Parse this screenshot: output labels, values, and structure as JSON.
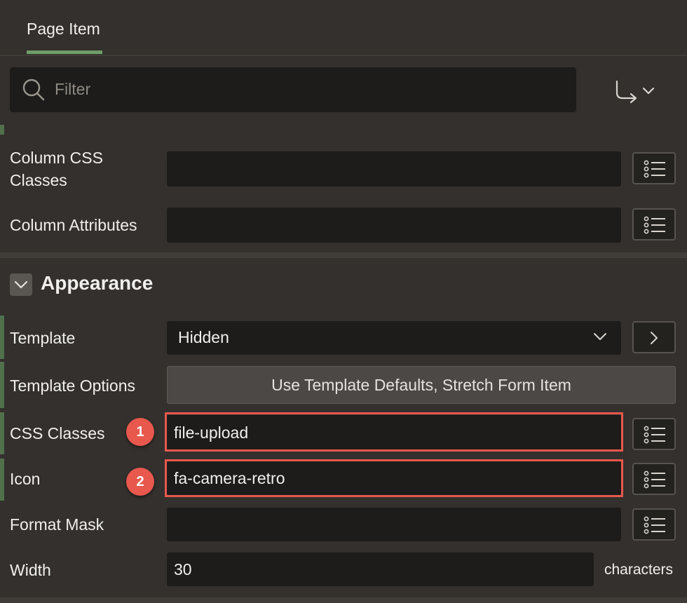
{
  "tabs": [
    {
      "label": "Page Item",
      "active": true
    }
  ],
  "filter": {
    "placeholder": "Filter"
  },
  "layout_section": {
    "fields": [
      {
        "label": "Column CSS Classes",
        "label_lines": [
          "Column CSS",
          "Classes"
        ],
        "value": ""
      },
      {
        "label": "Column Attributes",
        "value": ""
      }
    ]
  },
  "appearance": {
    "title": "Appearance",
    "template": {
      "label": "Template",
      "value": "Hidden"
    },
    "template_options": {
      "label": "Template Options",
      "value": "Use Template Defaults, Stretch Form Item"
    },
    "css_classes": {
      "label": "CSS Classes",
      "value": "file-upload",
      "callout": "1"
    },
    "icon": {
      "label": "Icon",
      "value": "fa-camera-retro",
      "callout": "2"
    },
    "format_mask": {
      "label": "Format Mask",
      "value": ""
    },
    "width": {
      "label": "Width",
      "value": "30",
      "unit": "characters"
    }
  },
  "colors": {
    "background": "#33302d",
    "field": "#1d1c1a",
    "accent": "#6f9e69",
    "highlight": "#e8584d"
  },
  "icons": [
    "search-icon",
    "go-to-group-icon",
    "chevron-down-icon",
    "list-icon",
    "chevron-right-icon"
  ]
}
